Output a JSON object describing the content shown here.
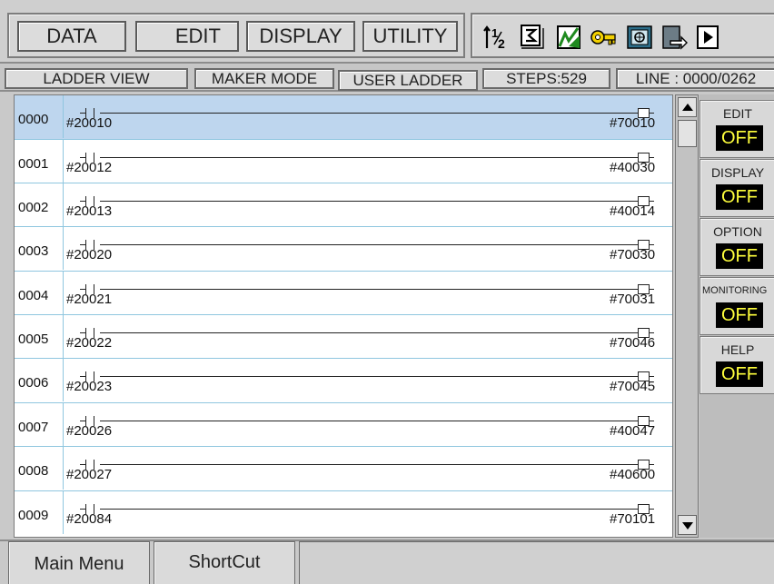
{
  "menu": {
    "data": "DATA",
    "edit": "EDIT",
    "display": "DISPLAY",
    "utility": "UTILITY"
  },
  "toolbar": {
    "icons": [
      "sort-numeric-icon",
      "step-box-icon",
      "chart-edit-icon",
      "key-lock-icon",
      "monitor-screen-icon",
      "export-file-icon",
      "play-next-icon"
    ]
  },
  "status": {
    "view": "LADDER VIEW",
    "mode": "MAKER MODE",
    "ladder": "USER LADDER",
    "steps": "STEPS:529",
    "line": "LINE : 0000/0262"
  },
  "ladder": {
    "rows": [
      {
        "num": "0000",
        "input": "#20010",
        "output": "#70010"
      },
      {
        "num": "0001",
        "input": "#20012",
        "output": "#40030"
      },
      {
        "num": "0002",
        "input": "#20013",
        "output": "#40014"
      },
      {
        "num": "0003",
        "input": "#20020",
        "output": "#70030"
      },
      {
        "num": "0004",
        "input": "#20021",
        "output": "#70031"
      },
      {
        "num": "0005",
        "input": "#20022",
        "output": "#70046"
      },
      {
        "num": "0006",
        "input": "#20023",
        "output": "#70045"
      },
      {
        "num": "0007",
        "input": "#20026",
        "output": "#40047"
      },
      {
        "num": "0008",
        "input": "#20027",
        "output": "#40600"
      },
      {
        "num": "0009",
        "input": "#20084",
        "output": "#70101"
      }
    ]
  },
  "side": {
    "edit": {
      "label": "EDIT",
      "value": "OFF"
    },
    "display": {
      "label": "DISPLAY",
      "value": "OFF"
    },
    "option": {
      "label": "OPTION",
      "value": "OFF"
    },
    "monitoring": {
      "label": "MONITORING",
      "value": "OFF"
    },
    "help": {
      "label": "HELP",
      "value": "OFF"
    }
  },
  "footer": {
    "main_menu": "Main Menu",
    "shortcut": "ShortCut"
  },
  "colors": {
    "selected_row": "#bed6ee",
    "row_divider": "#8fc6df",
    "toggle_value_text": "#ffff3c"
  }
}
